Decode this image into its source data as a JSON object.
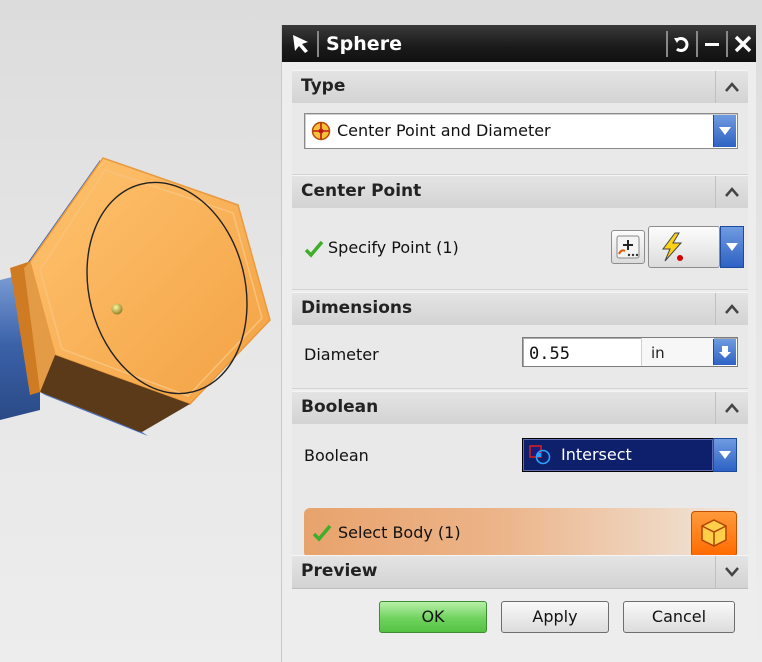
{
  "dialog": {
    "title": "Sphere",
    "sections": {
      "type": {
        "header": "Type",
        "selected_option": "Center Point and Diameter"
      },
      "center_point": {
        "header": "Center Point",
        "specify_label": "Specify Point (1)"
      },
      "dimensions": {
        "header": "Dimensions",
        "diameter_label": "Diameter",
        "diameter_value": "0.55",
        "unit": "in"
      },
      "boolean": {
        "header": "Boolean",
        "boolean_label": "Boolean",
        "boolean_value": "Intersect",
        "select_body_label": "Select Body (1)"
      },
      "preview": {
        "header": "Preview"
      }
    },
    "buttons": {
      "ok": "OK",
      "apply": "Apply",
      "cancel": "Cancel"
    }
  },
  "colors": {
    "titlebar": "#1a1a1a",
    "ok_green": "#6fd25e",
    "select_highlight": "#e8a36c",
    "boolean_selected_bg": "#0e1f6b",
    "combo_arrow_blue": "#2e62c4",
    "checkmark_green": "#3fae2a",
    "model_orange": "#f7a94a",
    "model_blue": "#4b6fb5"
  },
  "icons": {
    "title_selection": "selection-arrow-icon",
    "reset": "reset-icon",
    "minimize": "minimize-icon",
    "close": "close-icon",
    "type_option": "center-point-diameter-icon",
    "check": "green-checkmark-icon",
    "point_dialog": "point-dialog-icon",
    "inferred_point": "inferred-point-icon",
    "intersect": "intersect-icon",
    "select_body": "solid-body-icon"
  }
}
